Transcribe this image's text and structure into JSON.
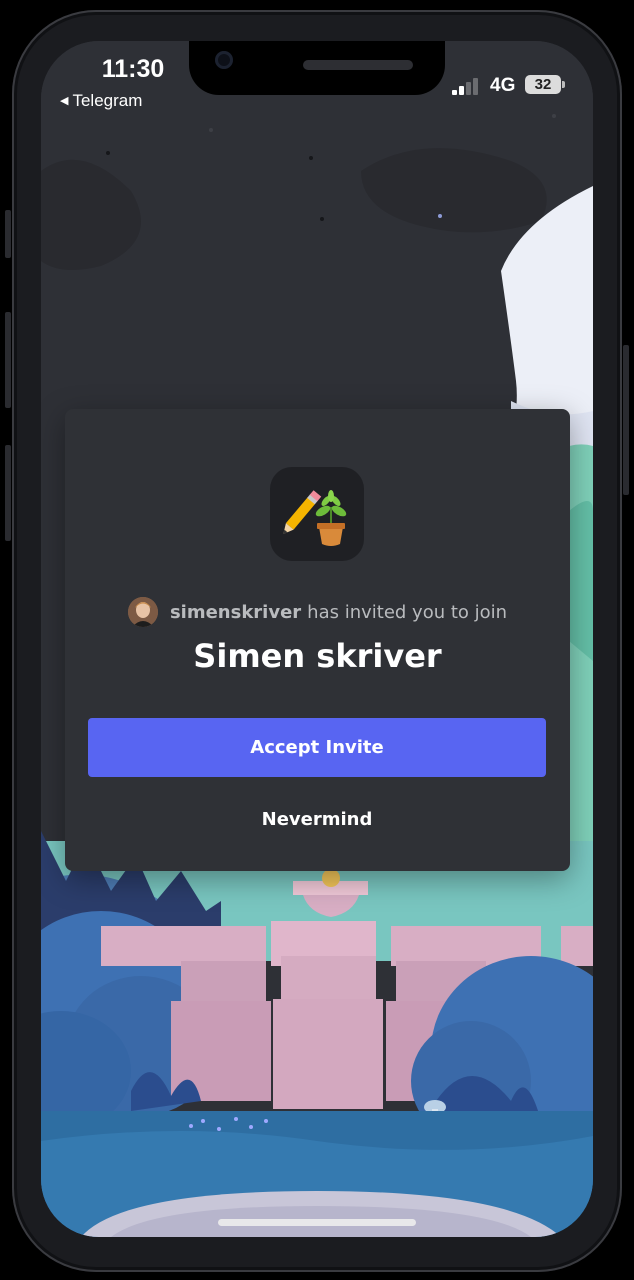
{
  "status_bar": {
    "time": "11:30",
    "back_app": "Telegram",
    "network": "4G",
    "battery": "32"
  },
  "invite": {
    "inviter": "simenskriver",
    "invite_text": "has invited you to join",
    "server_name": "Simen skriver",
    "server_icon": "pencil-and-potted-plant-emoji-icon",
    "accept_label": "Accept Invite",
    "nevermind_label": "Nevermind"
  },
  "colors": {
    "accent": "#5865f2",
    "card_bg": "#2f3136",
    "page_bg": "#2e3036"
  }
}
